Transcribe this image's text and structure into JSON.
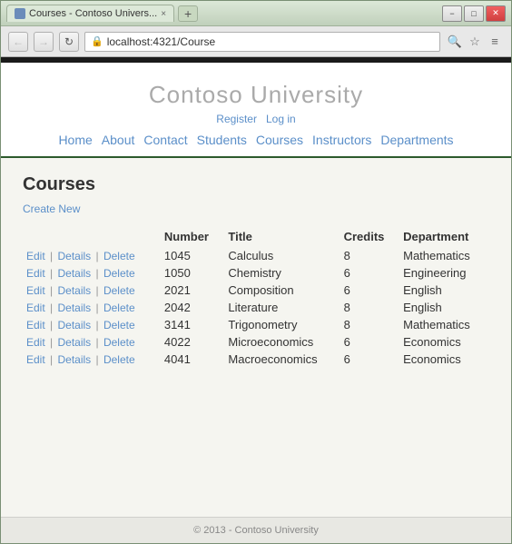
{
  "window": {
    "title": "Courses - Contoso Univers...",
    "url": "localhost:4321/Course",
    "tab_close_label": "×",
    "new_tab_label": "+",
    "controls": {
      "minimize": "−",
      "maximize": "□",
      "close": "✕"
    },
    "nav": {
      "back": "←",
      "forward": "→",
      "refresh": "↻"
    },
    "url_actions": {
      "search": "🔍",
      "star": "☆",
      "menu": "≡"
    }
  },
  "site": {
    "title": "Contoso University",
    "auth": {
      "register": "Register",
      "login": "Log in"
    },
    "nav": [
      "Home",
      "About",
      "Contact",
      "Students",
      "Courses",
      "Instructors",
      "Departments"
    ]
  },
  "page": {
    "title": "Courses",
    "create_new": "Create New",
    "table": {
      "headers": [
        "Number",
        "Title",
        "Credits",
        "Department"
      ],
      "rows": [
        {
          "number": "1045",
          "title": "Calculus",
          "credits": "8",
          "department": "Mathematics"
        },
        {
          "number": "1050",
          "title": "Chemistry",
          "credits": "6",
          "department": "Engineering"
        },
        {
          "number": "2021",
          "title": "Composition",
          "credits": "6",
          "department": "English"
        },
        {
          "number": "2042",
          "title": "Literature",
          "credits": "8",
          "department": "English"
        },
        {
          "number": "3141",
          "title": "Trigonometry",
          "credits": "8",
          "department": "Mathematics"
        },
        {
          "number": "4022",
          "title": "Microeconomics",
          "credits": "6",
          "department": "Economics"
        },
        {
          "number": "4041",
          "title": "Macroeconomics",
          "credits": "6",
          "department": "Economics"
        }
      ],
      "actions": {
        "edit": "Edit",
        "details": "Details",
        "delete": "Delete"
      }
    }
  },
  "footer": {
    "copyright": "© 2013 - Contoso University"
  }
}
